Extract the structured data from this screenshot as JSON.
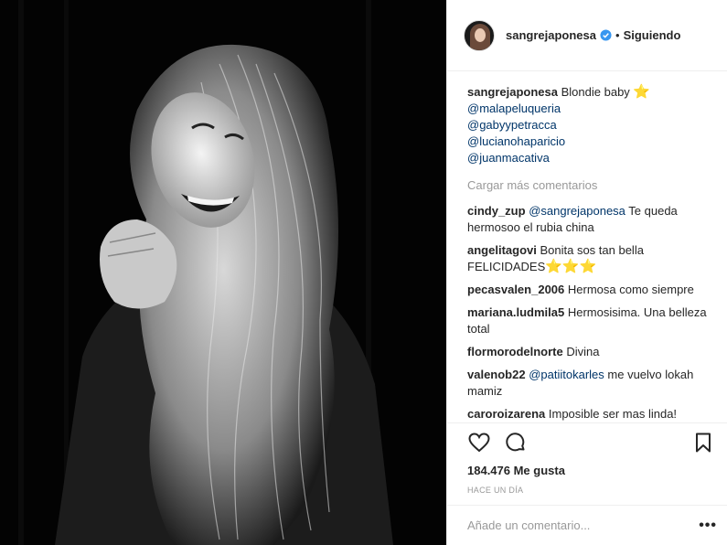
{
  "header": {
    "username": "sangrejaponesa",
    "separator": "•",
    "following_label": "Siguiendo"
  },
  "caption": {
    "username": "sangrejaponesa",
    "text": "Blondie baby",
    "emoji": "⭐",
    "mentions": [
      "@malapeluqueria",
      "@gabyypetracca",
      "@lucianohaparicio",
      "@juanmacativa"
    ]
  },
  "load_more_label": "Cargar más comentarios",
  "comments": [
    {
      "user": "cindy_zup",
      "mention": "@sangrejaponesa",
      "text": " Te queda hermosoo el rubia china"
    },
    {
      "user": "angelitagovi",
      "mention": "",
      "text": " Bonita sos tan bella FELICIDADES",
      "emoji": "⭐⭐⭐"
    },
    {
      "user": "pecasvalen_2006",
      "mention": "",
      "text": " Hermosa como siempre"
    },
    {
      "user": "mariana.ludmila5",
      "mention": "",
      "text": " Hermosisima. Una belleza total"
    },
    {
      "user": "flormorodelnorte",
      "mention": "",
      "text": " Divina"
    },
    {
      "user": "valenob22",
      "mention": "@patiitokarles",
      "text": " me vuelvo lokah mamiz"
    },
    {
      "user": "caroroizarena",
      "mention": "",
      "text": " Imposible ser mas linda!"
    }
  ],
  "likes_text": "184.476 Me gusta",
  "time_text": "Hace un día",
  "add_comment_placeholder": "Añade un comentario...",
  "more_label": "•••",
  "colors": {
    "mention": "#003569",
    "verified": "#3897f0",
    "muted": "#999999"
  },
  "icons": [
    "heart-icon",
    "comment-icon",
    "bookmark-icon",
    "verified-icon",
    "more-icon"
  ]
}
